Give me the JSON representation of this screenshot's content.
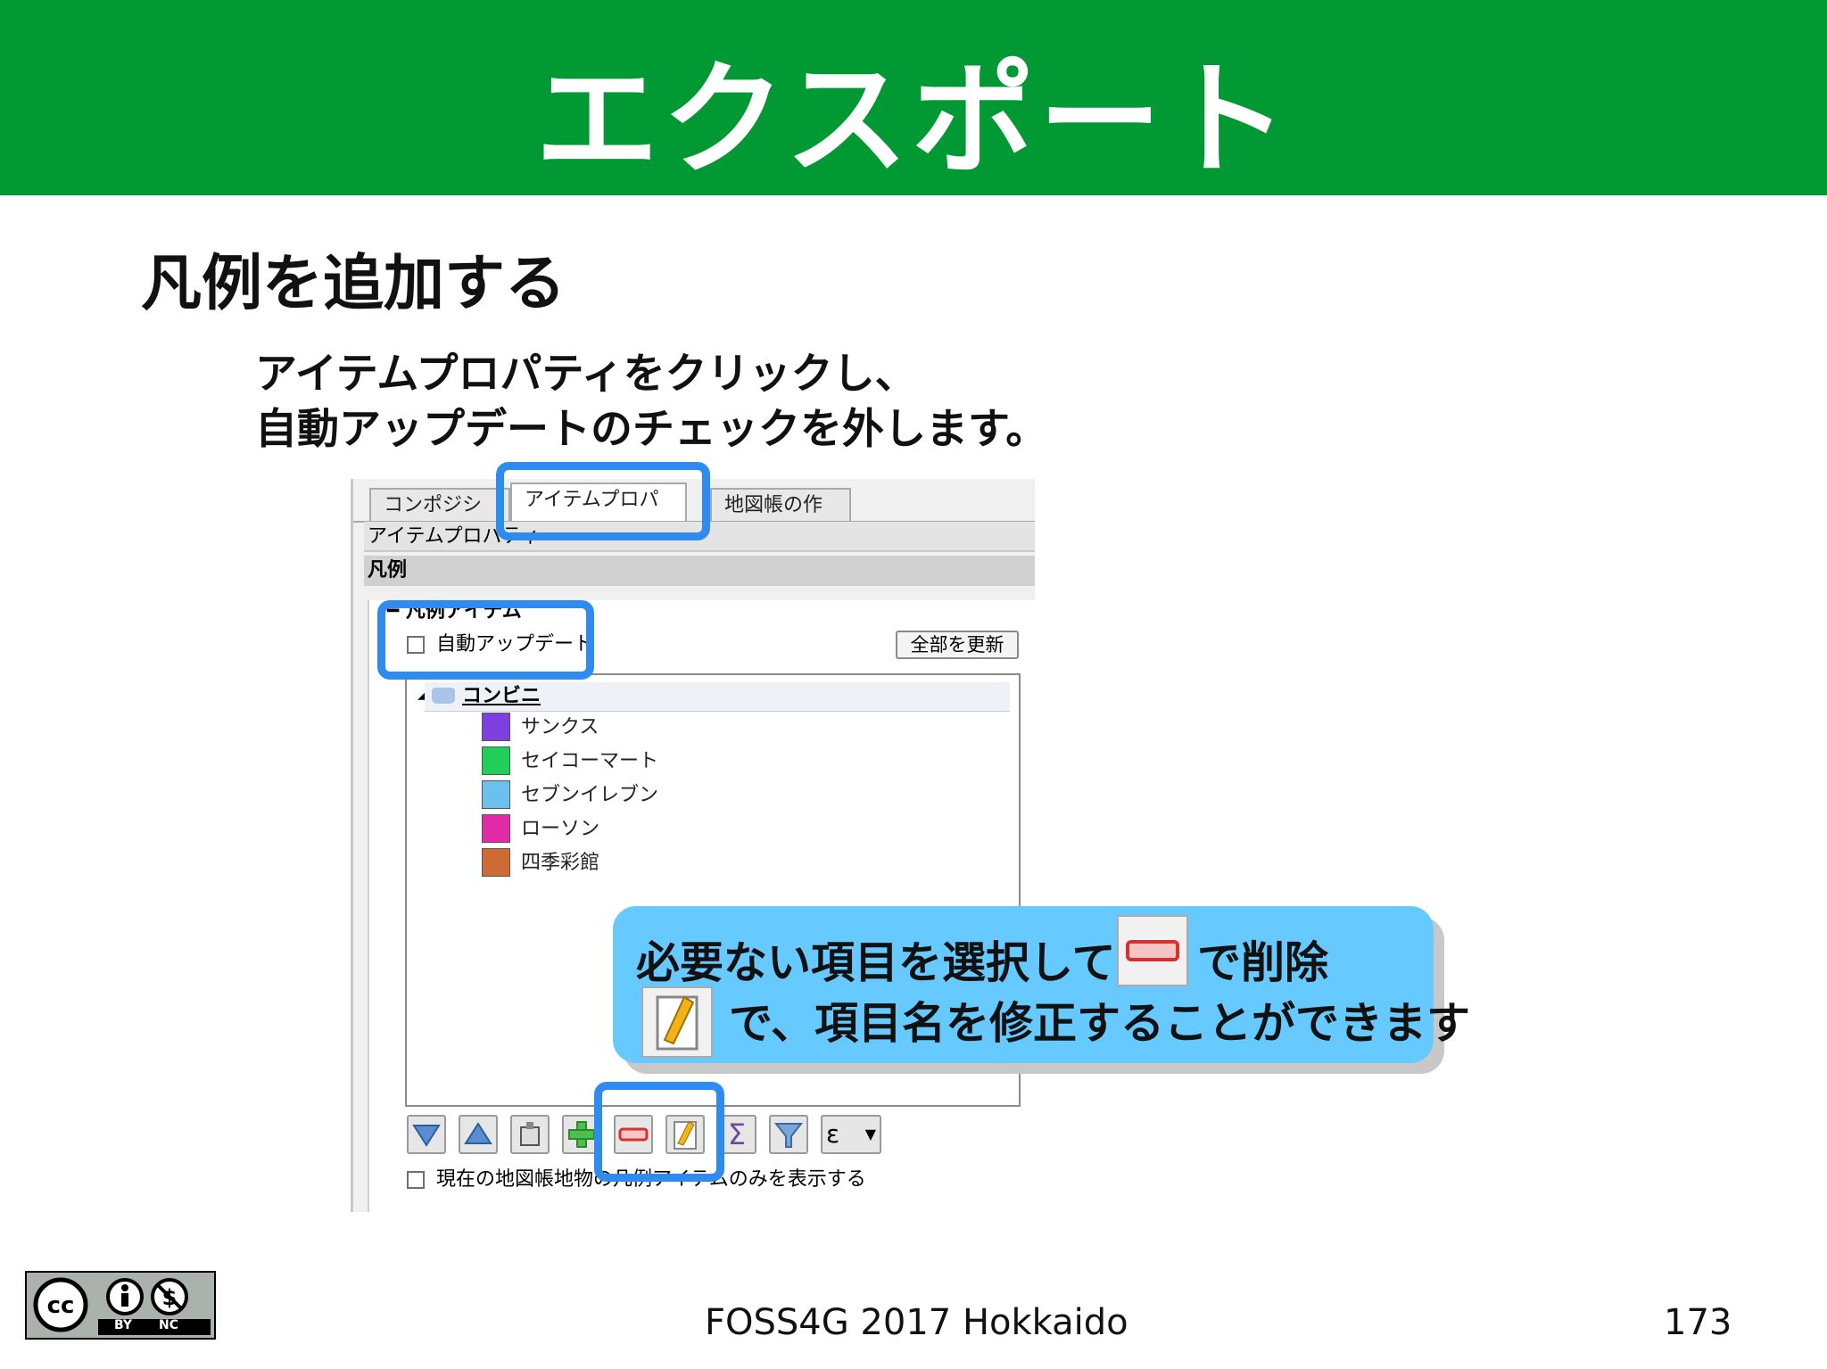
{
  "slide": {
    "title": "エクスポート",
    "heading": "凡例を追加する",
    "instruction_line1": "アイテムプロパティをクリックし、",
    "instruction_line2": "自動アップデートのチェックを外します。",
    "footer": "FOSS4G 2017 Hokkaido",
    "page_number": "173",
    "license_badge": {
      "label_by": "BY",
      "label_nc": "NC",
      "icon": "creative-commons-icon"
    }
  },
  "panel": {
    "tabs": [
      {
        "label": "コンポジション",
        "active": false
      },
      {
        "label": "アイテムプロパティ",
        "active": true
      },
      {
        "label": "地図帳の作成",
        "active": false
      }
    ],
    "section_title": "アイテムプロパティ",
    "group_title": "凡例",
    "subgroup_title": "凡例アイテム",
    "auto_update_label": "自動アップデート",
    "auto_update_checked": false,
    "refresh_all_label": "全部を更新",
    "tree": {
      "group_label": "コンビニ",
      "items": [
        {
          "label": "サンクス",
          "color": "#7d3fe0"
        },
        {
          "label": "セイコーマート",
          "color": "#1fcf5a"
        },
        {
          "label": "セブンイレブン",
          "color": "#6cc0ee"
        },
        {
          "label": "ローソン",
          "color": "#e22aa6"
        },
        {
          "label": "四季彩館",
          "color": "#cd6a36"
        }
      ]
    },
    "toolbar_icons": [
      "move-down-icon",
      "move-up-icon",
      "add-group-icon",
      "add-item-icon",
      "remove-item-icon",
      "edit-item-icon",
      "sum-icon",
      "filter-icon",
      "expression-icon"
    ],
    "filter_checkbox_label": "現在の地図帳地物の凡例アイテムのみを表示する"
  },
  "callout": {
    "line1_text": "必要ない項目を選択して",
    "line1_suffix": "で削除",
    "line2_text": "で、項目名を修正することができます"
  },
  "colors": {
    "header_bg": "#009933",
    "highlight": "#2e8cf0",
    "callout_bg": "#66c9ff"
  }
}
